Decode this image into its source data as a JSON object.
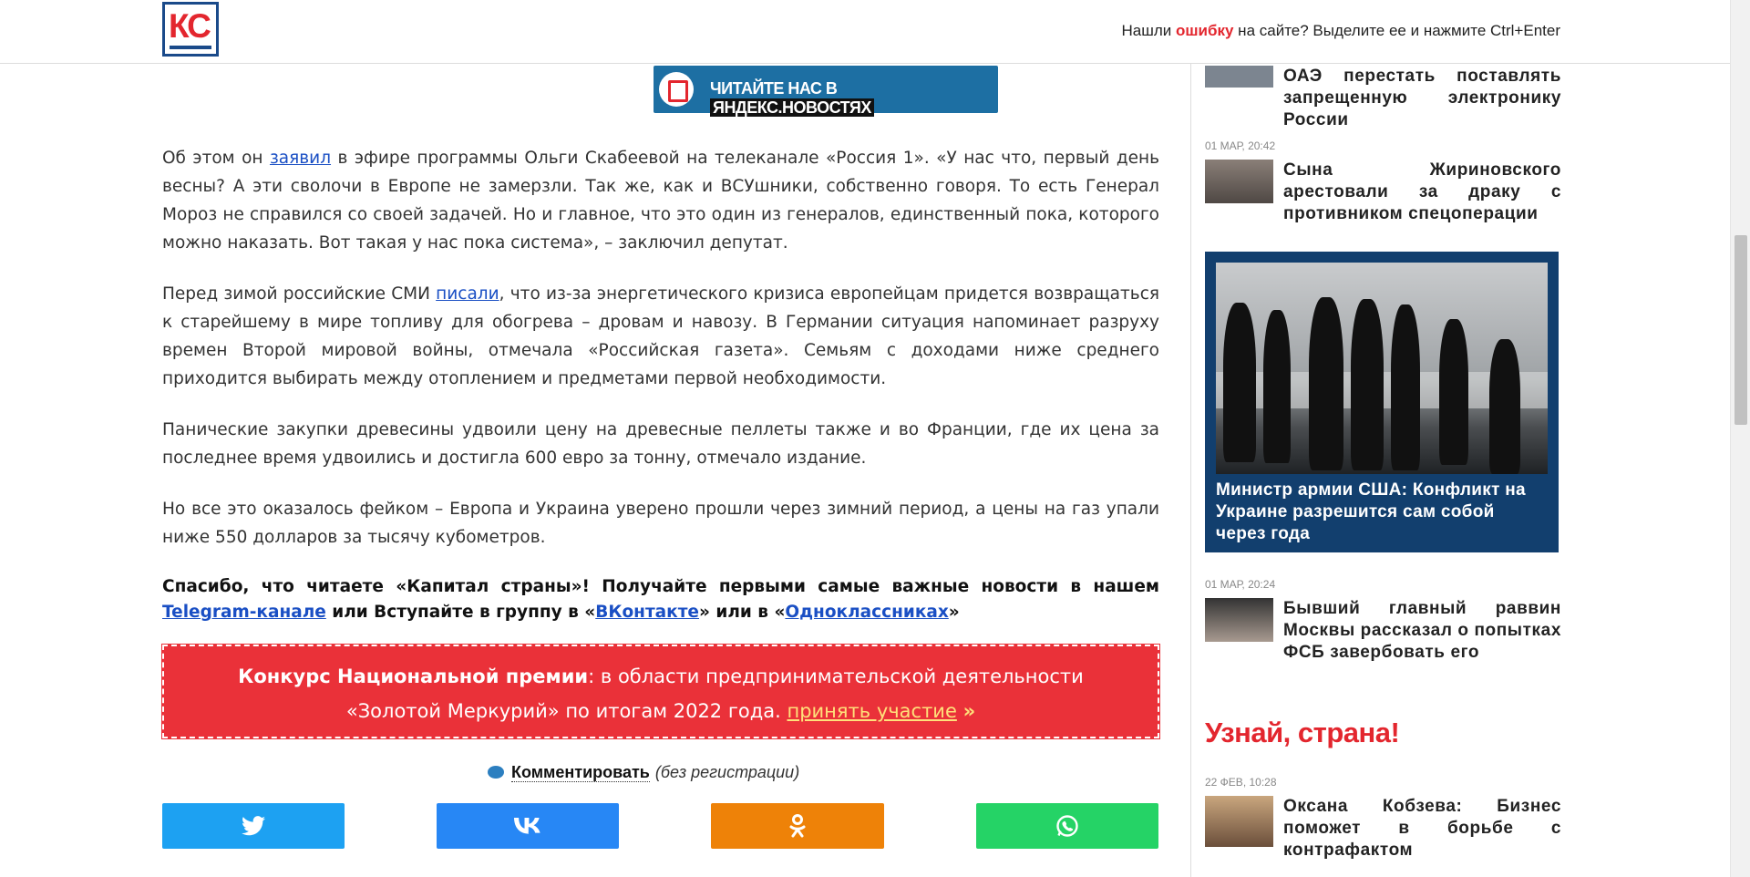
{
  "header": {
    "logo_text": "КС",
    "error_notice": {
      "before": "Нашли ",
      "highlight": "ошибку",
      "after": " на сайте? Выделите ее и нажмите Ctrl+Enter"
    }
  },
  "yandex_banner": {
    "text_main": "ЧИТАЙТЕ НАС В ",
    "text_highlight": "ЯНДЕКС.НОВОСТЯХ"
  },
  "article": {
    "p1": {
      "before_link": "Об этом он ",
      "link": "заявил",
      "after_link": " в эфире программы Ольги Скабеевой на телеканале «Россия 1». «У нас что, первый день весны? А эти сволочи в Европе не замерзли. Так же, как и ВСУшники, собственно говоря. То есть Генерал Мороз не справился со своей задачей. Но и главное, что это один из генералов, единственный пока, которого можно наказать. Вот такая у нас пока система», – заключил депутат."
    },
    "p2": {
      "before_link": "Перед зимой российские СМИ ",
      "link": "писали",
      "after_link": ", что из-за энергетического кризиса европейцам придется возвращаться к старейшему в мире топливу для обогрева – дровам и навозу. В Германии ситуация напоминает разруху времен Второй мировой войны, отмечала «Российская газета». Семьям с доходами ниже среднего приходится выбирать между отоплением и предметами первой необходимости."
    },
    "p3": "Панические закупки древесины удвоили цену на древесные пеллеты также и во Франции, где их цена за последнее время удвоились и достигла 600 евро за тонну, отмечало издание.",
    "p4": "Но все это оказалось фейком – Европа и Украина уверено прошли через зимний период, а цены на газ упали ниже 550 долларов за тысячу кубометров.",
    "p5": {
      "text1": "Спасибо, что читаете «Капитал страны»! Получайте первыми самые важные новости в нашем ",
      "link_telegram": "Telegram-канале",
      "text2": " или Вступайте в группу в «",
      "link_vk": "ВКонтакте",
      "text3": "» или в «",
      "link_ok": "Одноклассниках",
      "text4": "»"
    }
  },
  "contest": {
    "bold": "Конкурс Национальной премии",
    "text": ": в области предпринимательской деятельности «Золотой Меркурий» по итогам 2022 года. ",
    "link": "принять участие",
    "arrow": "»"
  },
  "comment": {
    "label": "Комментировать",
    "suffix": "(без регистрации)"
  },
  "shares": {
    "twitter_icon": "twitter-icon",
    "vk_icon": "vk-icon",
    "ok_icon": "ok-icon",
    "whatsapp_icon": "whatsapp-icon"
  },
  "sidebar": {
    "items": [
      {
        "date": "",
        "title": "ОАЭ перестать поставлять запрещенную электронику России"
      },
      {
        "date": "01 МАР, 20:42",
        "title": "Сына Жириновского арестовали за драку с противником спецоперации"
      },
      {
        "date": "01 МАР, 20:24",
        "title": "Бывший главный раввин Москвы рассказал о попытках ФСБ завербовать его"
      },
      {
        "date": "22 ФЕВ, 10:28",
        "title": "Оксана Кобзева: Бизнес поможет в борьбе с контрафактом"
      }
    ],
    "featured_title": "Министр армии США: Конфликт на Украине разрешится сам собой через года",
    "promo_heading": "Узнай, страна!"
  },
  "colors": {
    "brand_red": "#e3262e",
    "brand_blue": "#1a4a8a",
    "link": "#1a4fc4",
    "featured_bg": "#123f6e"
  }
}
